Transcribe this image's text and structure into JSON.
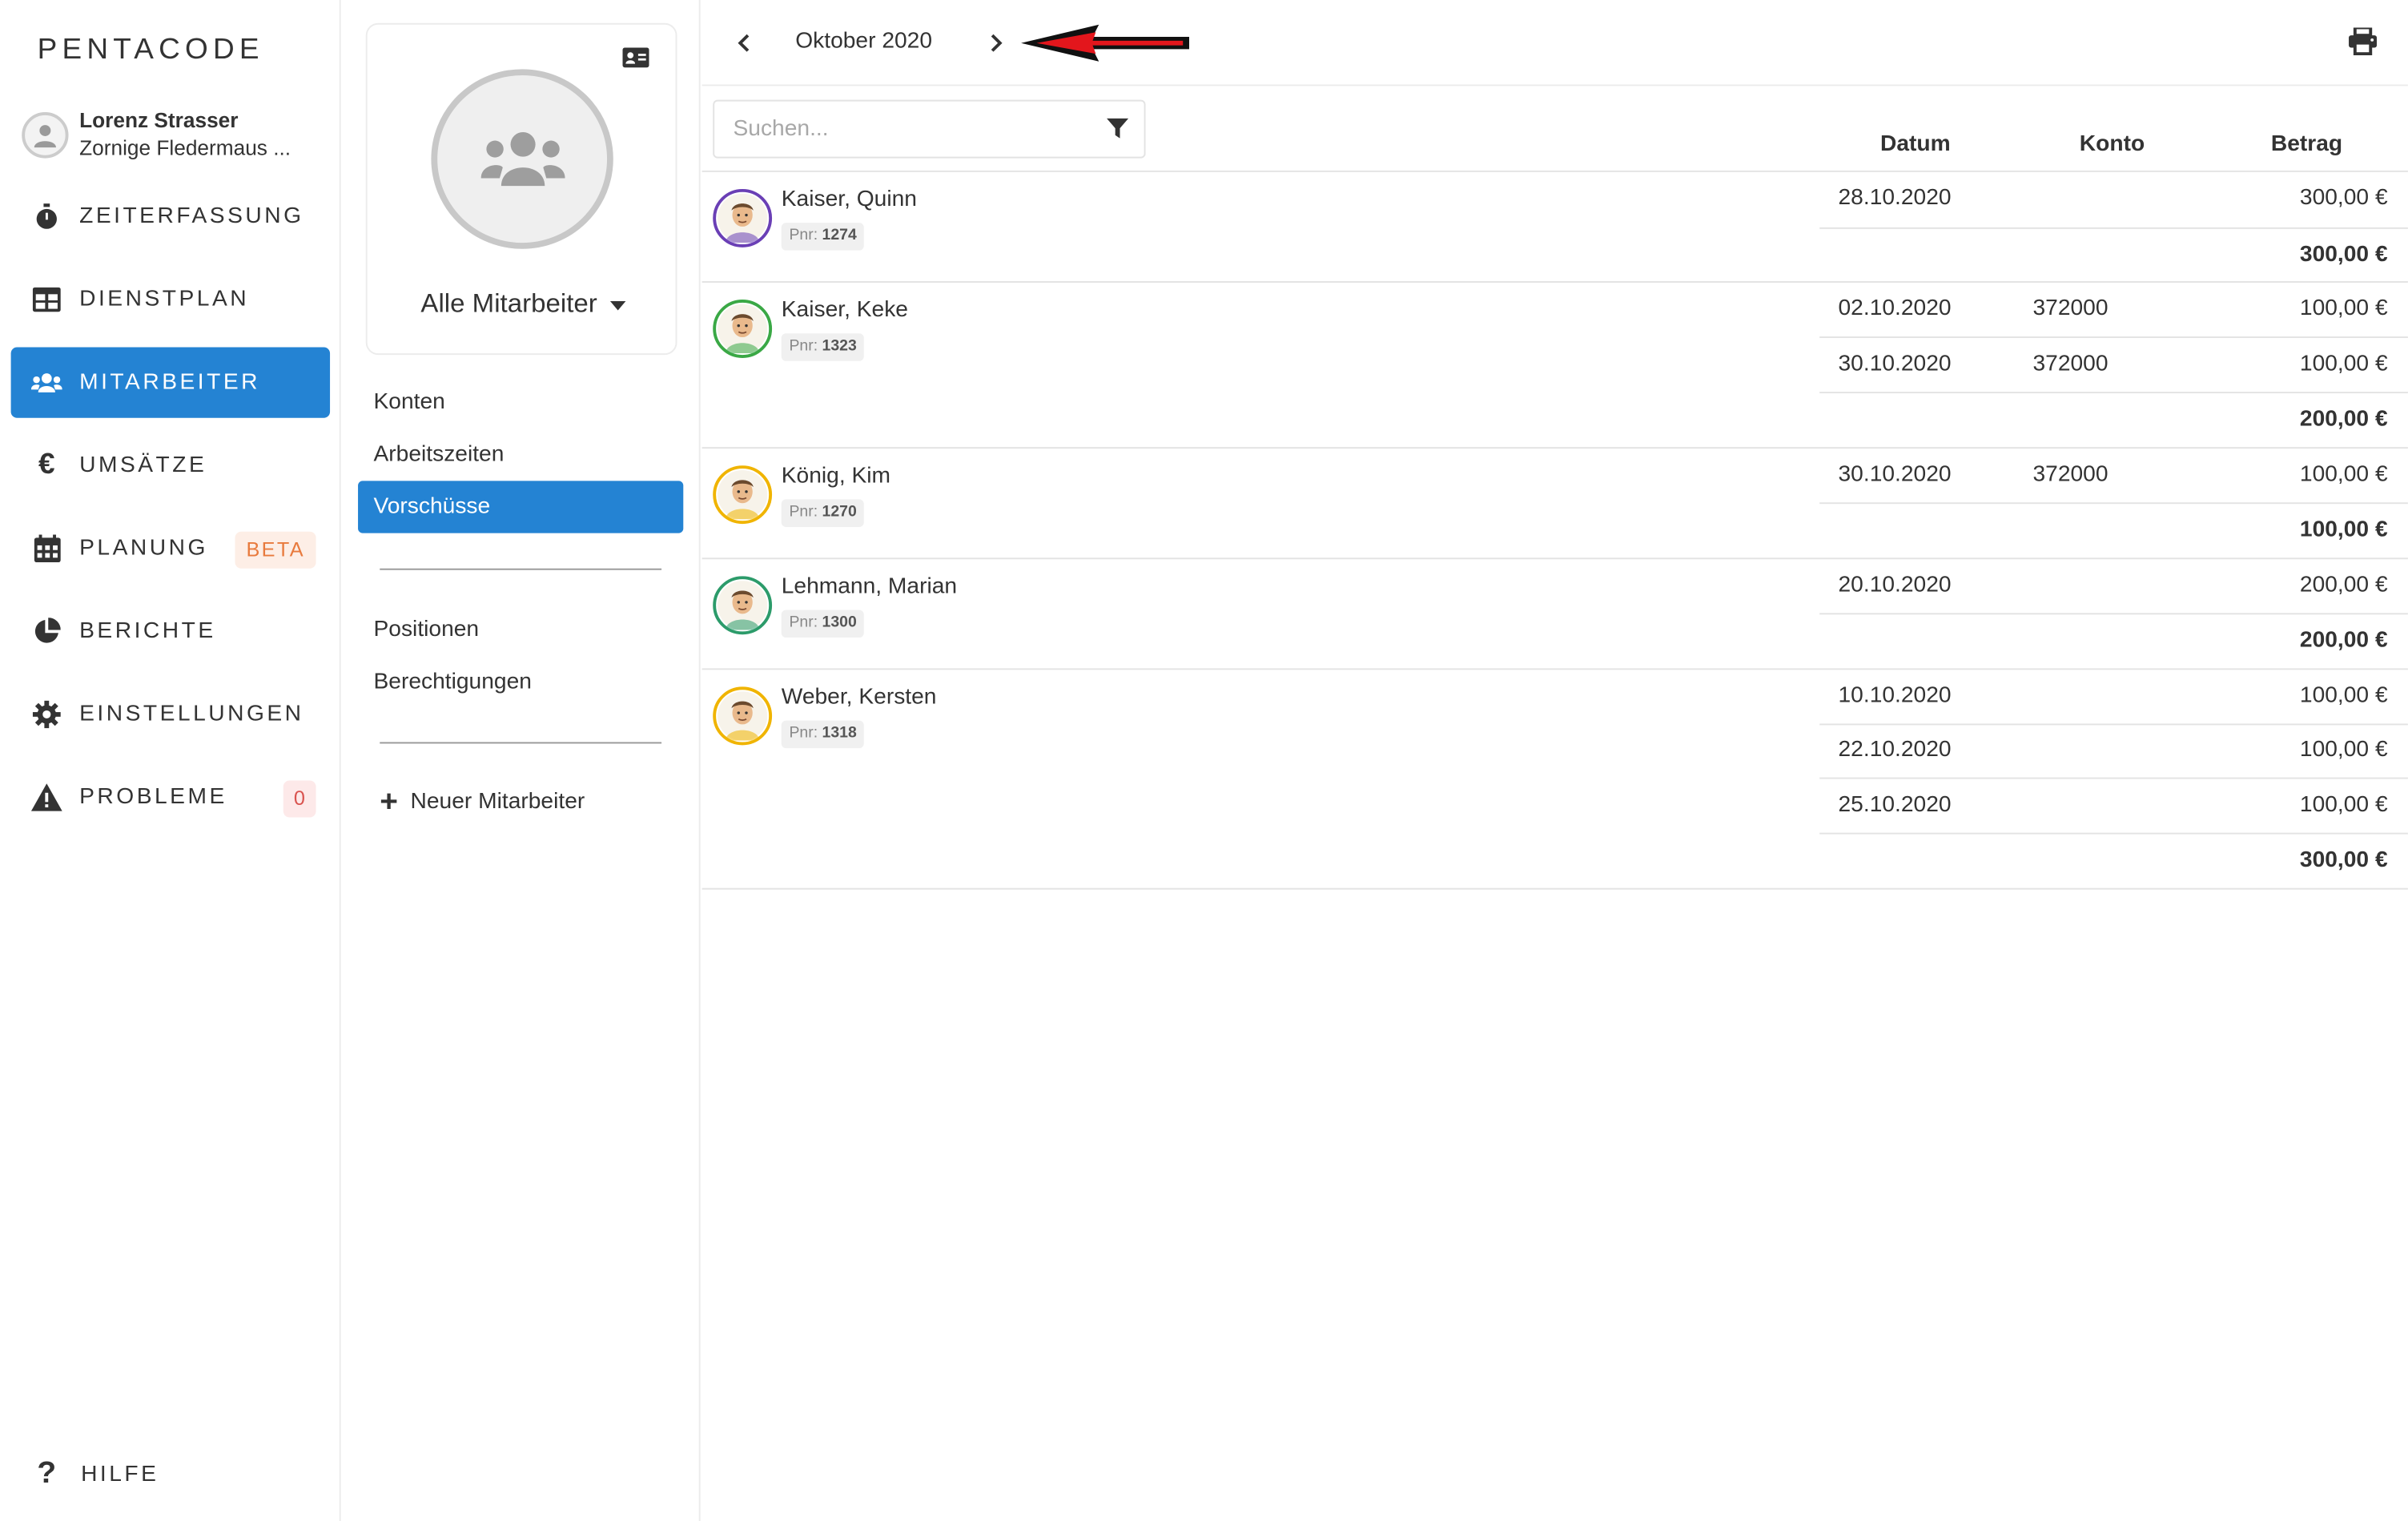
{
  "app": {
    "logo": "PENTACODE"
  },
  "user": {
    "name": "Lorenz Strasser",
    "subtitle": "Zornige Fledermaus ..."
  },
  "nav": [
    {
      "label": "ZEITERFASSUNG",
      "icon": "stopwatch-icon"
    },
    {
      "label": "DIENSTPLAN",
      "icon": "table-icon"
    },
    {
      "label": "MITARBEITER",
      "icon": "users-icon",
      "active": true
    },
    {
      "label": "UMSÄTZE",
      "icon": "euro-icon"
    },
    {
      "label": "PLANUNG",
      "icon": "calendar-icon",
      "badge": "BETA"
    },
    {
      "label": "BERICHTE",
      "icon": "pie-chart-icon"
    },
    {
      "label": "EINSTELLUNGEN",
      "icon": "gear-icon"
    },
    {
      "label": "PROBLEME",
      "icon": "warning-icon",
      "badge": "0"
    }
  ],
  "help": {
    "label": "HILFE",
    "icon": "question-icon"
  },
  "employee_card": {
    "selector_label": "Alle Mitarbeiter"
  },
  "submenu": {
    "group1": [
      "Konten",
      "Arbeitszeiten",
      "Vorschüsse"
    ],
    "active": "Vorschüsse",
    "group2": [
      "Positionen",
      "Berechtigungen"
    ],
    "new_employee": "Neuer Mitarbeiter"
  },
  "toolbar": {
    "month": "Oktober 2020"
  },
  "search": {
    "placeholder": "Suchen..."
  },
  "columns": {
    "date": "Datum",
    "account": "Konto",
    "amount": "Betrag"
  },
  "colors": {
    "accent": "#2483d3",
    "beta_badge": "#e87a3d",
    "problem_badge": "#d9534f"
  },
  "employees": [
    {
      "name": "Kaiser, Quinn",
      "pnr_label": "Pnr:",
      "pnr": "1274",
      "ring": "#6a3fb5",
      "rows": [
        {
          "date": "28.10.2020",
          "account": "",
          "amount": "300,00 €"
        }
      ],
      "total": "300,00 €"
    },
    {
      "name": "Kaiser, Keke",
      "pnr_label": "Pnr:",
      "pnr": "1323",
      "ring": "#3aa845",
      "rows": [
        {
          "date": "02.10.2020",
          "account": "372000",
          "amount": "100,00 €"
        },
        {
          "date": "30.10.2020",
          "account": "372000",
          "amount": "100,00 €"
        }
      ],
      "total": "200,00 €"
    },
    {
      "name": "König, Kim",
      "pnr_label": "Pnr:",
      "pnr": "1270",
      "ring": "#f0b400",
      "rows": [
        {
          "date": "30.10.2020",
          "account": "372000",
          "amount": "100,00 €"
        }
      ],
      "total": "100,00 €"
    },
    {
      "name": "Lehmann, Marian",
      "pnr_label": "Pnr:",
      "pnr": "1300",
      "ring": "#2c9b6a",
      "rows": [
        {
          "date": "20.10.2020",
          "account": "",
          "amount": "200,00 €"
        }
      ],
      "total": "200,00 €"
    },
    {
      "name": "Weber, Kersten",
      "pnr_label": "Pnr:",
      "pnr": "1318",
      "ring": "#f0b400",
      "rows": [
        {
          "date": "10.10.2020",
          "account": "",
          "amount": "100,00 €"
        },
        {
          "date": "22.10.2020",
          "account": "",
          "amount": "100,00 €"
        },
        {
          "date": "25.10.2020",
          "account": "",
          "amount": "100,00 €"
        }
      ],
      "total": "300,00 €"
    }
  ]
}
